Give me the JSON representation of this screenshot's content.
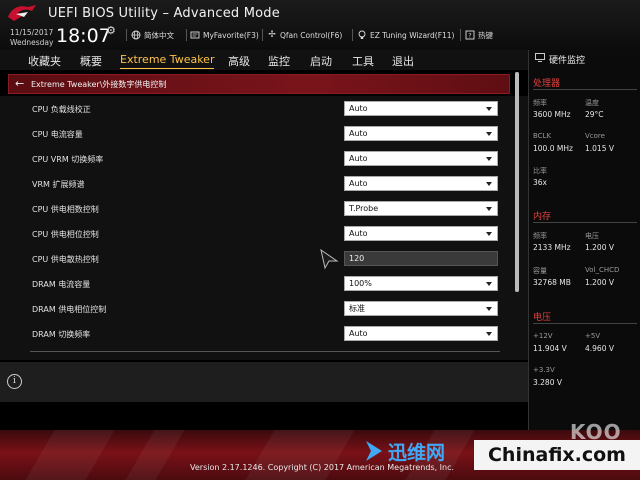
{
  "header": {
    "title": "UEFI BIOS Utility – Advanced Mode",
    "date": "11/15/2017",
    "weekday": "Wednesday",
    "time": "18:07",
    "buttons": [
      {
        "label": "简体中文",
        "icon": "globe-icon"
      },
      {
        "label": "MyFavorite(F3)",
        "icon": "favorite-icon"
      },
      {
        "label": "Qfan Control(F6)",
        "icon": "fan-icon"
      },
      {
        "label": "EZ Tuning Wizard(F11)",
        "icon": "bulb-icon"
      },
      {
        "label": "热键",
        "icon": "hotkey-icon"
      }
    ]
  },
  "tabs": [
    {
      "label": "收藏夹",
      "active": false
    },
    {
      "label": "概要",
      "active": false
    },
    {
      "label": "Extreme Tweaker",
      "active": true
    },
    {
      "label": "高级",
      "active": false
    },
    {
      "label": "监控",
      "active": false
    },
    {
      "label": "启动",
      "active": false
    },
    {
      "label": "工具",
      "active": false
    },
    {
      "label": "退出",
      "active": false
    }
  ],
  "breadcrumb": "Extreme Tweaker\\外接数字供电控制",
  "settings": [
    {
      "label": "CPU 负载线校正",
      "value": "Auto",
      "type": "select"
    },
    {
      "label": "CPU 电流容量",
      "value": "Auto",
      "type": "select"
    },
    {
      "label": "CPU VRM 切换频率",
      "value": "Auto",
      "type": "select"
    },
    {
      "label": "VRM 扩展频谱",
      "value": "Auto",
      "type": "select"
    },
    {
      "label": "CPU 供电相数控制",
      "value": "T.Probe",
      "type": "select"
    },
    {
      "label": "CPU 供电相位控制",
      "value": "Auto",
      "type": "select"
    },
    {
      "label": "CPU 供电散热控制",
      "value": "120",
      "type": "input"
    },
    {
      "label": "DRAM 电流容量",
      "value": "100%",
      "type": "select"
    },
    {
      "label": "DRAM 供电相位控制",
      "value": "标准",
      "type": "select"
    },
    {
      "label": "DRAM 切换频率",
      "value": "Auto",
      "type": "select"
    }
  ],
  "hw_monitor": {
    "title": "硬件监控",
    "cpu": {
      "section": "处理器",
      "freq_label": "频率",
      "freq_value": "3600 MHz",
      "temp_label": "温度",
      "temp_value": "29°C",
      "bclk_label": "BCLK",
      "bclk_value": "100.0 MHz",
      "vcore_label": "Vcore",
      "vcore_value": "1.015 V",
      "ratio_label": "比率",
      "ratio_value": "36x"
    },
    "memory": {
      "section": "内存",
      "freq_label": "频率",
      "freq_value": "2133 MHz",
      "volt_label": "电压",
      "volt_value": "1.200 V",
      "cap_label": "容量",
      "cap_value": "32768 MB",
      "vol_chcd_label": "Vol_CHCD",
      "vol_chcd_value": "1.200 V"
    },
    "voltage": {
      "section": "电压",
      "v12_label": "+12V",
      "v12_value": "11.904 V",
      "v5_label": "+5V",
      "v5_value": "4.960 V",
      "v33_label": "+3.3V",
      "v33_value": "3.280 V"
    }
  },
  "footer": {
    "version": "Version 2.17.1246. Copyright (C) 2017 American Megatrends, Inc."
  },
  "watermarks": {
    "xunwei": "迅维网",
    "chinafix": "Chinafix.com",
    "koo": "KOO"
  },
  "colors": {
    "accent_tab": "#ffc24a",
    "section_red": "#e04040",
    "crumb_bg": "#7a141b"
  }
}
